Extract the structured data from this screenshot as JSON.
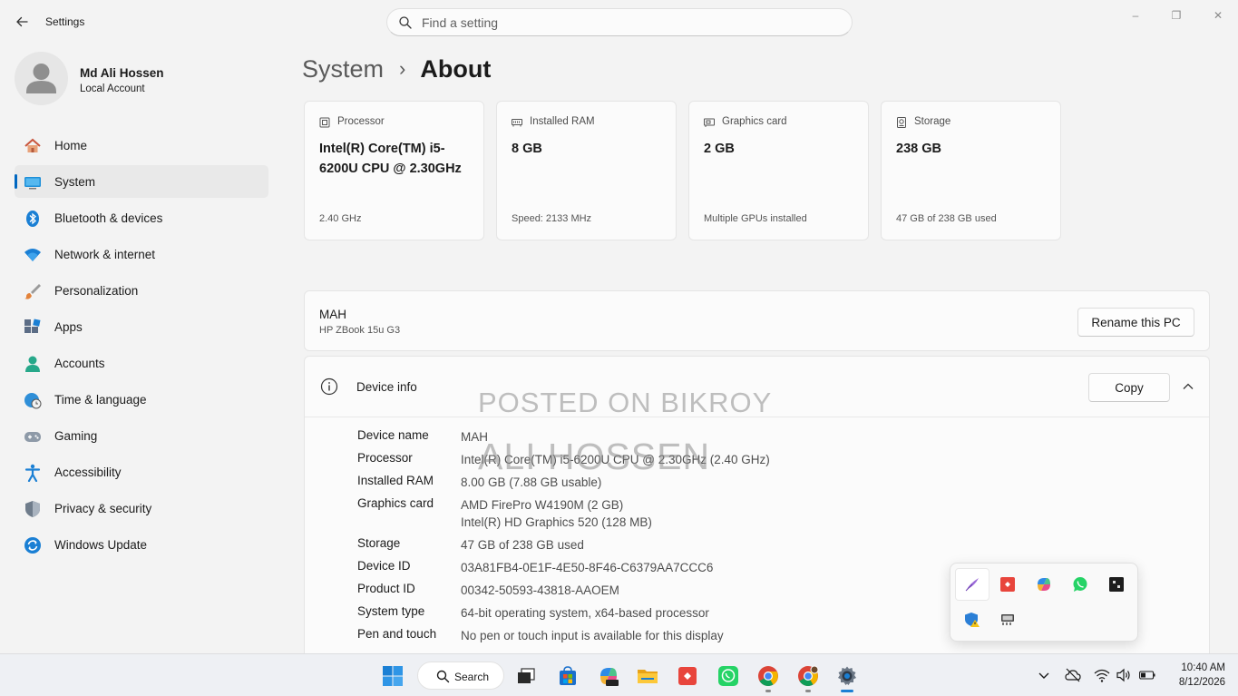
{
  "window": {
    "title": "Settings",
    "controls": {
      "minimize": "–",
      "maximize": "❐",
      "close": "✕"
    }
  },
  "search": {
    "placeholder": "Find a setting"
  },
  "profile": {
    "name": "Md Ali Hossen",
    "account_type": "Local Account"
  },
  "sidebar": {
    "items": [
      {
        "label": "Home",
        "icon": "home-icon"
      },
      {
        "label": "System",
        "icon": "system-icon",
        "active": true
      },
      {
        "label": "Bluetooth & devices",
        "icon": "bluetooth-icon"
      },
      {
        "label": "Network & internet",
        "icon": "wifi-icon"
      },
      {
        "label": "Personalization",
        "icon": "brush-icon"
      },
      {
        "label": "Apps",
        "icon": "apps-icon"
      },
      {
        "label": "Accounts",
        "icon": "accounts-icon"
      },
      {
        "label": "Time & language",
        "icon": "clock-globe-icon"
      },
      {
        "label": "Gaming",
        "icon": "gamepad-icon"
      },
      {
        "label": "Accessibility",
        "icon": "accessibility-icon"
      },
      {
        "label": "Privacy & security",
        "icon": "shield-icon"
      },
      {
        "label": "Windows Update",
        "icon": "update-icon"
      }
    ]
  },
  "breadcrumb": {
    "parent": "System",
    "separator": "›",
    "current": "About"
  },
  "spec_cards": [
    {
      "title": "Processor",
      "value": "Intel(R) Core(TM) i5-6200U CPU @ 2.30GHz",
      "sub": "2.40 GHz",
      "icon": "processor-icon"
    },
    {
      "title": "Installed RAM",
      "value": "8 GB",
      "sub": "Speed: 2133 MHz",
      "icon": "ram-icon"
    },
    {
      "title": "Graphics card",
      "value": "2 GB",
      "sub": "Multiple GPUs installed",
      "icon": "graphics-card-icon"
    },
    {
      "title": "Storage",
      "value": "238 GB",
      "sub": "47 GB of 238 GB used",
      "icon": "storage-icon"
    }
  ],
  "pc": {
    "name": "MAH",
    "model": "HP ZBook 15u G3",
    "rename_label": "Rename this PC"
  },
  "device_info": {
    "title": "Device info",
    "copy_label": "Copy",
    "watermark_line1": "POSTED ON BIKROY",
    "watermark_line2": "ALI HOSSEN",
    "rows": [
      {
        "key": "Device name",
        "value": "MAH"
      },
      {
        "key": "Processor",
        "value": "Intel(R) Core(TM) i5-6200U CPU @ 2.30GHz (2.40 GHz)"
      },
      {
        "key": "Installed RAM",
        "value": "8.00 GB (7.88 GB usable)"
      },
      {
        "key": "Graphics card",
        "value": "AMD FirePro W4190M (2 GB)",
        "value2": "Intel(R) HD Graphics 520 (128 MB)"
      },
      {
        "key": "Storage",
        "value": "47 GB of 238 GB used"
      },
      {
        "key": "Device ID",
        "value": "03A81FB4-0E1F-4E50-8F46-C6379AA7CCC6"
      },
      {
        "key": "Product ID",
        "value": "00342-50593-43818-AAOEM"
      },
      {
        "key": "System type",
        "value": "64-bit operating system, x64-based processor"
      },
      {
        "key": "Pen and touch",
        "value": "No pen or touch input is available for this display"
      }
    ]
  },
  "tray_popup": {
    "icons": [
      "pen-feather-icon",
      "anydesk-icon",
      "copilot-icon",
      "whatsapp-icon",
      "app-dark-icon",
      "defender-warning-icon",
      "device-tray-icon"
    ]
  },
  "taskbar": {
    "search_label": "Search",
    "apps": [
      "windows-start-icon",
      "search-icon",
      "task-view-icon",
      "store-icon",
      "m365-icon",
      "file-explorer-icon",
      "anydesk-icon",
      "whatsapp-icon",
      "chrome-icon",
      "chrome-profile-icon",
      "settings-gear-icon"
    ],
    "time": "10:40 AM",
    "date": "8/12/2026"
  },
  "colors": {
    "accent": "#0067c0",
    "background": "#f3f3f3",
    "card": "#fbfbfb"
  }
}
